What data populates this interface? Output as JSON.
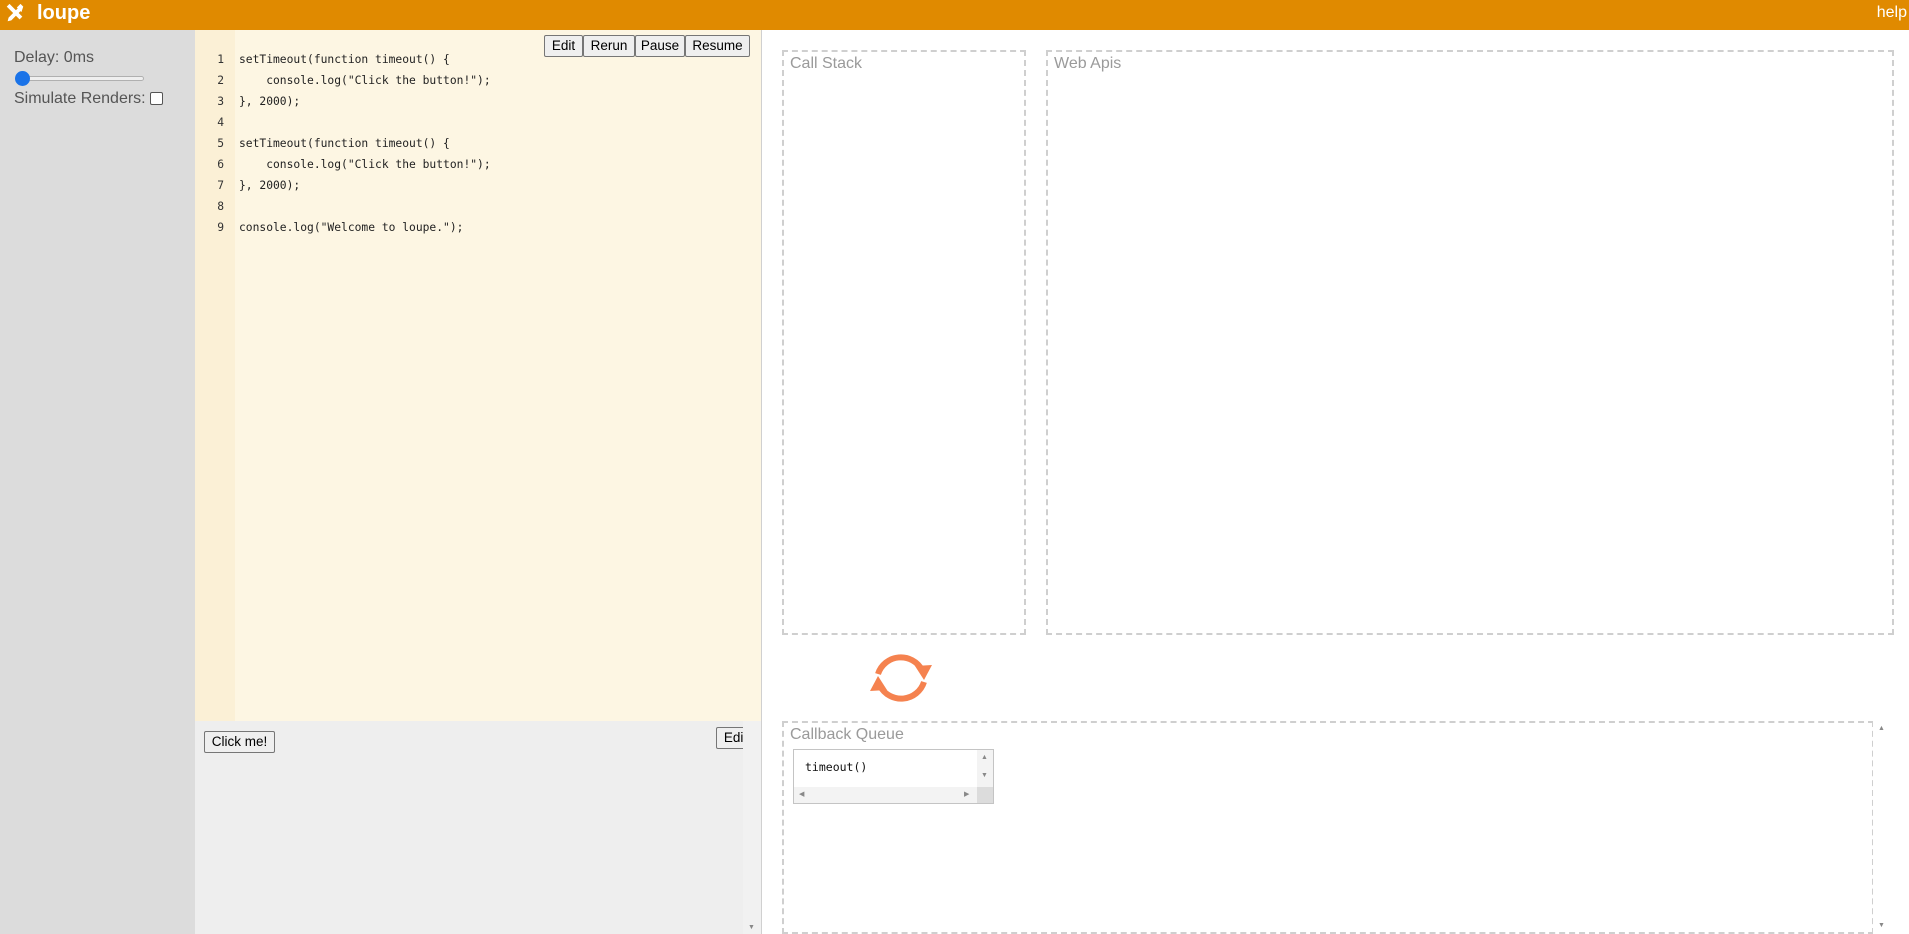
{
  "header": {
    "title": "loupe",
    "help": "help",
    "colors": {
      "bar": "#e08a00"
    }
  },
  "settings": {
    "delay_label": "Delay: 0ms",
    "delay_value_ms": 0,
    "simulate_renders_label": "Simulate Renders:",
    "simulate_renders_checked": false
  },
  "editor": {
    "buttons": {
      "edit": "Edit",
      "rerun": "Rerun",
      "pause": "Pause",
      "resume": "Resume"
    },
    "lines": [
      {
        "n": "1",
        "text": "setTimeout(function timeout() {"
      },
      {
        "n": "2",
        "text": "    console.log(\"Click the button!\");"
      },
      {
        "n": "3",
        "text": "}, 2000);"
      },
      {
        "n": "4",
        "text": ""
      },
      {
        "n": "5",
        "text": "setTimeout(function timeout() {"
      },
      {
        "n": "6",
        "text": "    console.log(\"Click the button!\");"
      },
      {
        "n": "7",
        "text": "}, 2000);"
      },
      {
        "n": "8",
        "text": ""
      },
      {
        "n": "9",
        "text": "console.log(\"Welcome to loupe.\");"
      }
    ]
  },
  "preview": {
    "click_button": "Click me!",
    "edit_button": "Edit"
  },
  "visualizer": {
    "call_stack_title": "Call Stack",
    "web_apis_title": "Web Apis",
    "callback_queue_title": "Callback Queue",
    "queue_items": [
      "timeout()"
    ],
    "event_loop_icon": "refresh-cycle-icon",
    "event_loop_color": "#f5824f"
  }
}
